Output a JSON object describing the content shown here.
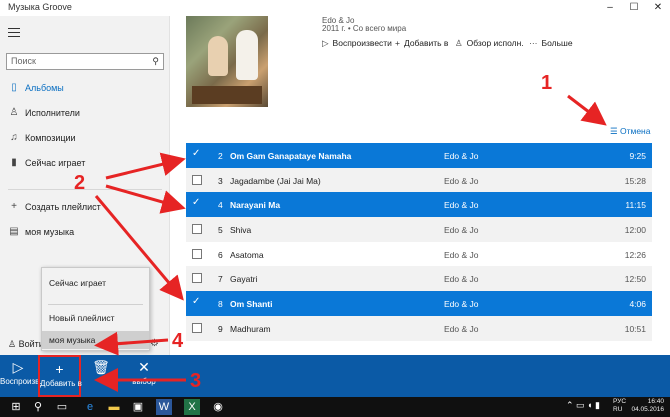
{
  "window": {
    "title": "Музыка Groove",
    "controls": [
      "–",
      "☐",
      "✕"
    ]
  },
  "sidebar": {
    "search_placeholder": "Поиск",
    "items": [
      {
        "label": "Альбомы",
        "icon": "album-icon",
        "active": true
      },
      {
        "label": "Исполнители",
        "icon": "person-icon"
      },
      {
        "label": "Композиции",
        "icon": "music-note-icon"
      },
      {
        "label": "Сейчас играет",
        "icon": "equalizer-icon"
      },
      {
        "label": "Создать плейлист",
        "icon": "plus-icon"
      },
      {
        "label": "моя музыка",
        "icon": "playlist-icon"
      }
    ],
    "login_label": "Войти"
  },
  "popup": {
    "items": [
      "Сейчас играет",
      "Новый плейлист",
      "моя музыка"
    ],
    "highlighted": 2
  },
  "album": {
    "artist": "Edo & Jo",
    "year_line": "2011 г. • Со всего мира",
    "actions": [
      "Воспроизвести",
      "Добавить в",
      "Обзор исполн.",
      "Больше"
    ]
  },
  "cancel_label": "Отмена",
  "tracks": [
    {
      "num": "2",
      "title": "Om Gam Ganapataye Namaha",
      "artist": "Edo & Jo",
      "duration": "9:25",
      "selected": true
    },
    {
      "num": "3",
      "title": "Jagadambe (Jai Jai Ma)",
      "artist": "Edo & Jo",
      "duration": "15:28",
      "selected": false
    },
    {
      "num": "4",
      "title": "Narayani Ma",
      "artist": "Edo & Jo",
      "duration": "11:15",
      "selected": true
    },
    {
      "num": "5",
      "title": "Shiva",
      "artist": "Edo & Jo",
      "duration": "12:00",
      "selected": false
    },
    {
      "num": "6",
      "title": "Asatoma",
      "artist": "Edo & Jo",
      "duration": "12:26",
      "selected": false
    },
    {
      "num": "7",
      "title": "Gayatri",
      "artist": "Edo & Jo",
      "duration": "12:50",
      "selected": false
    },
    {
      "num": "8",
      "title": "Om Shanti",
      "artist": "Edo & Jo",
      "duration": "4:06",
      "selected": true
    },
    {
      "num": "9",
      "title": "Madhuram",
      "artist": "Edo & Jo",
      "duration": "10:51",
      "selected": false
    }
  ],
  "appbar": {
    "play_label": "Воспроизв.",
    "add_label": "Добавить в",
    "clear_label": "выбор"
  },
  "taskbar": {
    "lang": "РУС\nRU",
    "time": "16:40",
    "date": "04.05.2016"
  },
  "annotations": [
    "1",
    "2",
    "3",
    "4"
  ],
  "colors": {
    "accent": "#0a78d7",
    "appbar": "#0b5aa6",
    "annotation": "#e62424"
  }
}
